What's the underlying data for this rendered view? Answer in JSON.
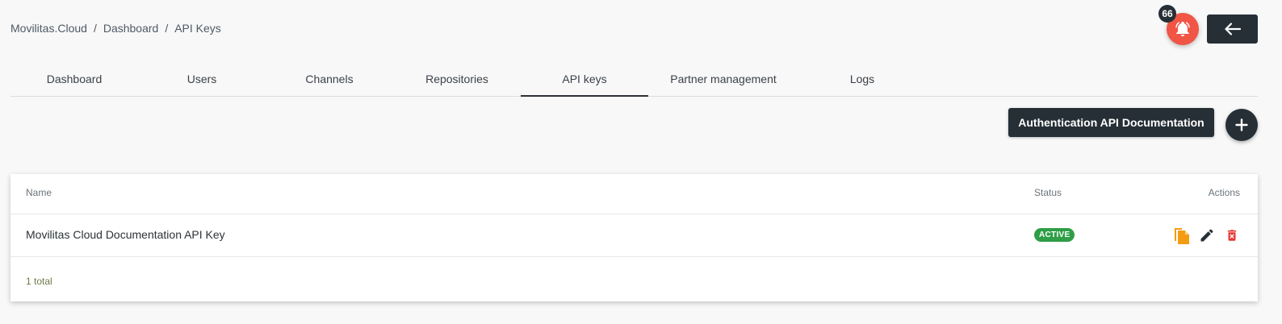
{
  "breadcrumb": {
    "items": [
      "Movilitas.Cloud",
      "Dashboard",
      "API Keys"
    ],
    "separator": "/"
  },
  "notifications": {
    "count": "66",
    "icon": "bell-icon",
    "color": "#f05545"
  },
  "back_button": {
    "icon": "arrow-left-icon"
  },
  "tabs": [
    {
      "label": "Dashboard",
      "active": false
    },
    {
      "label": "Users",
      "active": false
    },
    {
      "label": "Channels",
      "active": false
    },
    {
      "label": "Repositories",
      "active": false
    },
    {
      "label": "API keys",
      "active": true
    },
    {
      "label": "Partner management",
      "active": false
    },
    {
      "label": "Logs",
      "active": false
    }
  ],
  "toolbar": {
    "doc_label": "Authentication API Documentation",
    "add_icon": "plus-icon"
  },
  "table": {
    "columns": {
      "name": "Name",
      "status": "Status",
      "actions": "Actions"
    },
    "rows": [
      {
        "name": "Movilitas Cloud Documentation API Key",
        "status": "ACTIVE",
        "actions": [
          "copy-icon",
          "edit-icon",
          "delete-icon"
        ]
      }
    ],
    "total": "1 total"
  },
  "colors": {
    "dark": "#262f36",
    "active_badge": "#2e9e47",
    "copy_icon": "#f39c12",
    "delete_icon": "#e53935"
  }
}
